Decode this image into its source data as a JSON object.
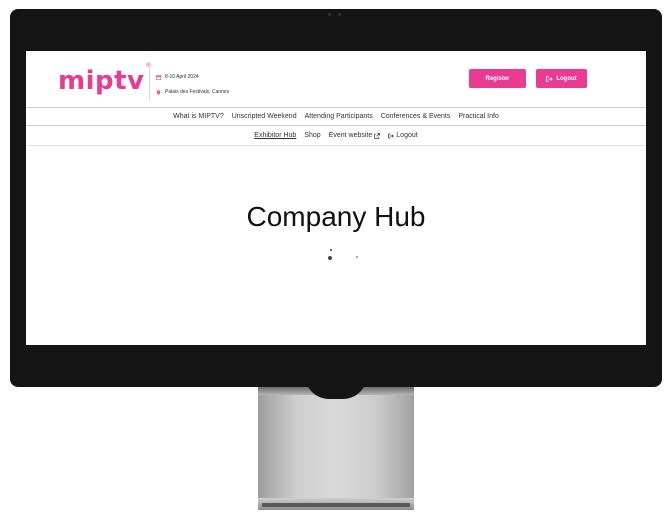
{
  "header": {
    "logo_text": "miptv",
    "logo_mark": "®",
    "date": "8-10 April 2024",
    "venue": "Palais des Festivals, Cannes",
    "register_label": "Register",
    "logout_label": "Logout"
  },
  "nav_primary": [
    {
      "label": "What is MIPTV?"
    },
    {
      "label": "Unscripted Weekend"
    },
    {
      "label": "Attending Participants"
    },
    {
      "label": "Conferences & Events"
    },
    {
      "label": "Practical Info"
    }
  ],
  "nav_secondary": {
    "exhibitor_hub": "Exhibitor Hub",
    "shop": "Shop",
    "event_website": "Event website",
    "logout": "Logout"
  },
  "main": {
    "title": "Company Hub"
  },
  "icons": {
    "calendar": "calendar-icon",
    "location": "map-pin-icon",
    "logout": "logout-icon",
    "external": "external-link-icon",
    "loading": "loading-spinner-icon"
  },
  "colors": {
    "brand_pink": "#e93b8f",
    "bezel": "#141414",
    "text": "#333333"
  }
}
